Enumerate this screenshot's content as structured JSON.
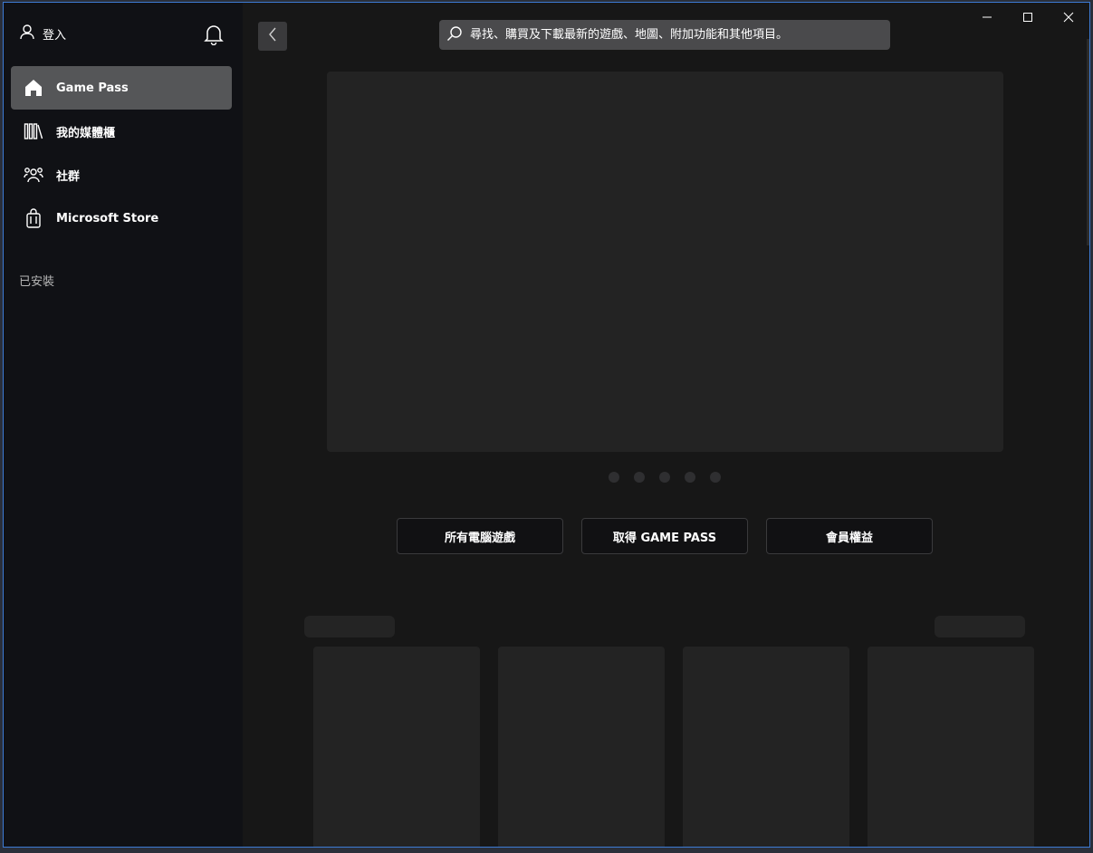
{
  "sidebar": {
    "signin_label": "登入",
    "items": [
      {
        "label": "Game Pass",
        "icon": "home-icon",
        "active": true
      },
      {
        "label": "我的媒體櫃",
        "icon": "library-icon",
        "active": false
      },
      {
        "label": "社群",
        "icon": "community-icon",
        "active": false
      },
      {
        "label": "Microsoft Store",
        "icon": "store-bag-icon",
        "active": false
      }
    ],
    "installed_label": "已安裝"
  },
  "search": {
    "placeholder": "尋找、購買及下載最新的遊戲、地圖、附加功能和其他項目。"
  },
  "carousel": {
    "dot_count": 5
  },
  "actions": {
    "all_pc_games": "所有電腦遊戲",
    "get_game_pass": "取得 GAME PASS",
    "member_benefits": "會員權益"
  },
  "colors": {
    "sidebar_bg": "#101115",
    "main_bg": "#171717",
    "active_item_bg": "#555658",
    "placeholder_fill": "#232323"
  }
}
